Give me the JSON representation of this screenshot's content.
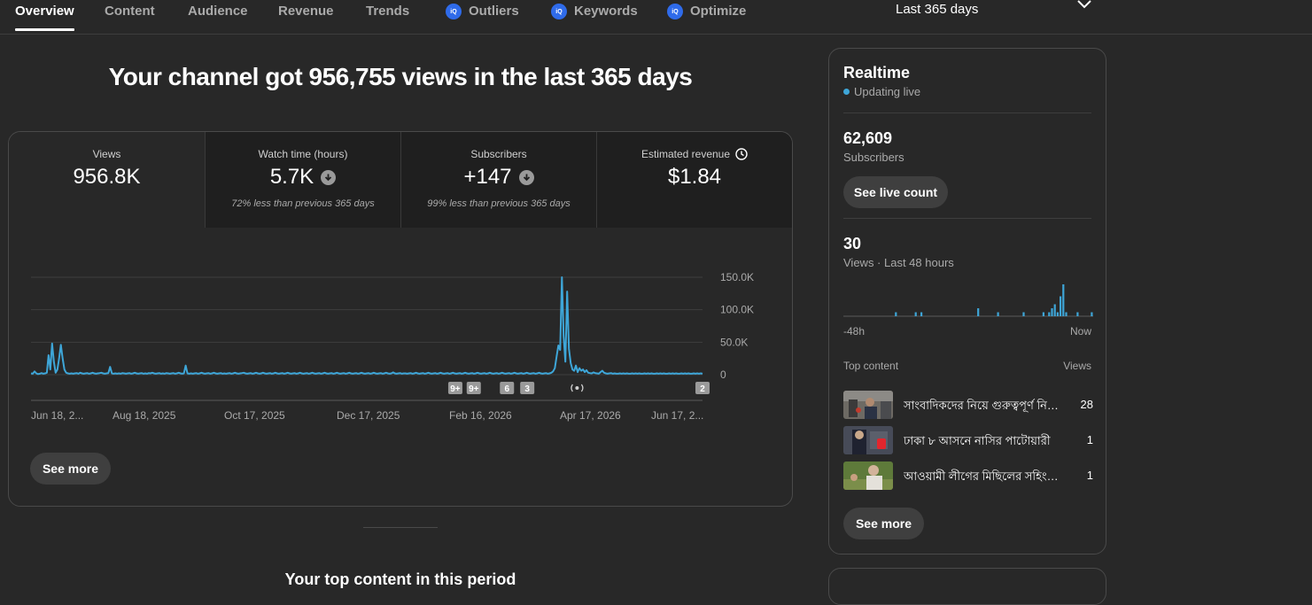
{
  "tabs": [
    {
      "label": "Overview",
      "active": true
    },
    {
      "label": "Content"
    },
    {
      "label": "Audience"
    },
    {
      "label": "Revenue"
    },
    {
      "label": "Trends"
    },
    {
      "label": "Outliers",
      "badge": "iQ"
    },
    {
      "label": "Keywords",
      "badge": "iQ"
    },
    {
      "label": "Optimize",
      "badge": "iQ"
    }
  ],
  "period": {
    "label": "Last 365 days",
    "icon": "chevron-down-icon"
  },
  "headline": "Your channel got 956,755 views in the last 365 days",
  "metrics": [
    {
      "label": "Views",
      "value": "956.8K",
      "note": ""
    },
    {
      "label": "Watch time (hours)",
      "value": "5.7K",
      "note": "72% less than previous 365 days",
      "icon": "arrow-down-circle-icon"
    },
    {
      "label": "Subscribers",
      "value": "+147",
      "note": "99% less than previous 365 days",
      "icon": "arrow-down-circle-icon"
    },
    {
      "label": "Estimated revenue",
      "value": "$1.84",
      "note": "",
      "icon": "clock-icon"
    }
  ],
  "chart_data": {
    "type": "line",
    "series": [
      {
        "values": [
          2000,
          1500,
          5000,
          2000,
          1000,
          1500,
          2500,
          1500,
          2000,
          3000,
          30000,
          8000,
          48000,
          20000,
          3000,
          8000,
          25000,
          46000,
          25000,
          8000,
          3000,
          2000,
          1500,
          2000,
          1500,
          2000,
          2500,
          1500,
          3000,
          2000,
          1500,
          2000,
          2500,
          1500,
          2000,
          3000,
          2000,
          1500,
          2000,
          2500,
          3000,
          2000,
          1500,
          2000,
          2500,
          12000,
          2000,
          1500,
          2000,
          1500,
          2000,
          1500,
          2500,
          2000,
          1500,
          2000,
          2500,
          1500,
          2000,
          3000,
          2000,
          1500,
          2000,
          2500,
          1500,
          2000,
          1500,
          2500,
          2000,
          3000,
          2000,
          1500,
          2000,
          2500,
          1500,
          2000,
          1500,
          2500,
          2000,
          1500,
          2000,
          2500,
          1500,
          2000,
          3000,
          2000,
          1500,
          2000,
          14000,
          2000,
          1500,
          2000,
          1500,
          2000,
          2500,
          1500,
          2000,
          3000,
          2000,
          1500,
          2000,
          2500,
          1500,
          2000,
          3000,
          2000,
          1500,
          2000,
          2500,
          1500,
          2000,
          1500,
          2000,
          2500,
          1500,
          2000,
          3000,
          2000,
          1500,
          2000,
          2500,
          3000,
          2000,
          1500,
          2000,
          2500,
          1500,
          2000,
          3000,
          2000,
          1500,
          2000,
          3000,
          2000,
          1500,
          2000,
          2500,
          1500,
          2000,
          3000,
          2000,
          1500,
          2000,
          2500,
          1500,
          2000,
          3000,
          2000,
          1500,
          2000,
          2500,
          1500,
          2000,
          3000,
          2000,
          1500,
          2000,
          2500,
          1500,
          2000,
          3000,
          2000,
          1500,
          2000,
          2500,
          1500,
          2000,
          3000,
          2000,
          1500,
          2000,
          2500,
          1500,
          2000,
          3000,
          2000,
          1500,
          2000,
          2500,
          1500,
          2000,
          3000,
          2000,
          1500,
          2000,
          2500,
          1500,
          2000,
          3000,
          2000,
          1500,
          2000,
          2500,
          1500,
          2000,
          3000,
          2000,
          1500,
          2000,
          2500,
          1500,
          2000,
          3000,
          2000,
          1500,
          2000,
          3500,
          2000,
          1500,
          2000,
          2500,
          1500,
          2000,
          2000,
          1500,
          2000,
          2500,
          1500,
          2000,
          3000,
          2000,
          1500,
          2000,
          2500,
          1500,
          2000,
          3000,
          2000,
          1500,
          2000,
          2500,
          1500,
          2000,
          3000,
          2000,
          1500,
          2000,
          2500,
          1500,
          2000,
          3000,
          2000,
          1500,
          2000,
          2500,
          1500,
          2000,
          3000,
          2000,
          1500,
          2000,
          2500,
          1500,
          2000,
          3000,
          2000,
          1500,
          2000,
          2500,
          1500,
          2000,
          3000,
          2000,
          1500,
          2000,
          2500,
          1500,
          2000,
          3000,
          2000,
          1500,
          2000,
          2500,
          1500,
          2000,
          3000,
          2000,
          1500,
          2000,
          2500,
          1500,
          2000,
          3000,
          2000,
          1500,
          2000,
          2500,
          1500,
          2000,
          3000,
          2000,
          1500,
          2000,
          2500,
          1500,
          2000,
          3000,
          5000,
          10000,
          28000,
          45000,
          38000,
          150000,
          60000,
          20000,
          128000,
          40000,
          18000,
          8000,
          6000,
          14000,
          4000,
          10000,
          6000,
          8000,
          4000,
          7000,
          3000,
          2500,
          2000,
          3500,
          2500,
          2000,
          1500,
          4000,
          6000,
          3000,
          2000,
          1500,
          2000,
          2500,
          1500,
          2000,
          1500,
          1500,
          2000,
          1500,
          2000,
          1500,
          2000,
          1500,
          1500,
          2000,
          1500,
          2000,
          1500,
          2000,
          1500,
          1500,
          2000,
          1500,
          2000,
          1500,
          2000,
          1500,
          1500,
          2000,
          1500,
          2000,
          1500,
          2000,
          1500,
          1500,
          2000,
          1500,
          2000,
          1500,
          2000,
          1500,
          1500,
          2000,
          1500,
          2000,
          1500,
          2000,
          1500,
          1500,
          2000,
          1500,
          2000,
          1500,
          2000,
          1500
        ]
      }
    ],
    "x_tick_labels": [
      "Jun 18, 2...",
      "Aug 18, 2025",
      "Oct 17, 2025",
      "Dec 17, 2025",
      "Feb 16, 2026",
      "Apr 17, 2026",
      "Jun 17, 2..."
    ],
    "y_tick_labels": [
      "150.0K",
      "100.0K",
      "50.0K",
      "0"
    ],
    "ylim": [
      0,
      150000
    ],
    "grid": true,
    "markers": [
      {
        "label": "9+",
        "date": "Feb 3, 2026"
      },
      {
        "label": "9+",
        "date": "Feb 13, 2026"
      },
      {
        "label": "6",
        "date": "Mar 3, 2026"
      },
      {
        "label": "3",
        "date": "Mar 14, 2026"
      },
      {
        "icon": "live-broadcast-icon",
        "date": "Apr 10, 2026"
      },
      {
        "label": "2",
        "date": "Jun 17, 2026"
      }
    ]
  },
  "see_more_label": "See more",
  "top_content_heading": "Your top content in this period",
  "realtime": {
    "title": "Realtime",
    "status": "Updating live",
    "subscribers_value": "62,609",
    "subscribers_label": "Subscribers",
    "live_count_button": "See live count",
    "views_value": "30",
    "views_label": "Views · Last 48 hours",
    "mini_chart": [
      0,
      0,
      0,
      0,
      0,
      0,
      0,
      0,
      0,
      0,
      0,
      0,
      0,
      0,
      0,
      0,
      0,
      0,
      1,
      0,
      0,
      0,
      0,
      0,
      0,
      1,
      0,
      1,
      0,
      0,
      0,
      0,
      0,
      0,
      0,
      0,
      0,
      0,
      0,
      0,
      0,
      0,
      0,
      0,
      0,
      0,
      0,
      2,
      0,
      0,
      0,
      0,
      0,
      0,
      1,
      0,
      0,
      0,
      0,
      0,
      0,
      0,
      0,
      1,
      0,
      0,
      0,
      0,
      0,
      0,
      1,
      0,
      1,
      2,
      3,
      1,
      5,
      8,
      1,
      0,
      0,
      0,
      1,
      0,
      0,
      0,
      0,
      1
    ],
    "axis_start": "-48h",
    "axis_end": "Now",
    "top_content_label": "Top content",
    "views_col_label": "Views",
    "items": [
      {
        "title": "সাংবাদিকদের নিয়ে গুরুত্বপূর্ণ নির্দেশনা",
        "views": "28"
      },
      {
        "title": "ঢাকা ৮ আসনে নাসির পাটোয়ারী",
        "views": "1"
      },
      {
        "title": "আওয়ামী লীগের মিছিলের সহিংসতা",
        "views": "1"
      }
    ],
    "see_more_label": "See more"
  },
  "colors": {
    "accent": "#3ea6d8",
    "background": "#282828",
    "panel": "#1f1f1f"
  }
}
